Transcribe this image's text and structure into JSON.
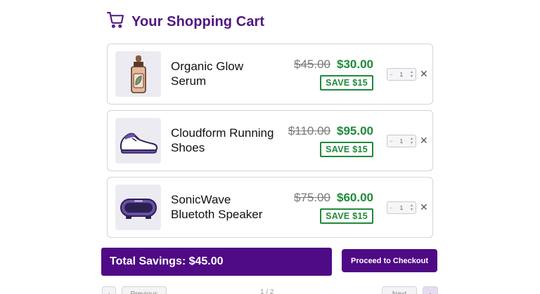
{
  "header": {
    "title": "Your Shopping Cart",
    "icon": "cart-icon",
    "accent": "#4f1782"
  },
  "items": [
    {
      "name": "Organic Glow Serum",
      "original_price": "$45.00",
      "sale_price": "$30.00",
      "savings_badge": "SAVE $15",
      "quantity": "1",
      "icon": "serum-bottle-icon"
    },
    {
      "name": "Cloudform Running Shoes",
      "original_price": "$110.00",
      "sale_price": "$95.00",
      "savings_badge": "SAVE $15",
      "quantity": "1",
      "icon": "running-shoe-icon"
    },
    {
      "name": "SonicWave Bluetoth Speaker",
      "original_price": "$75.00",
      "sale_price": "$60.00",
      "savings_badge": "SAVE $15",
      "quantity": "1",
      "icon": "speaker-icon"
    }
  ],
  "summary": {
    "total_savings": "Total Savings: $45.00",
    "checkout_label": "Proceed to Checkout"
  },
  "pagination": {
    "prev_label": "Previous",
    "page_text": "1 / 2",
    "next_label": "Next"
  },
  "colors": {
    "brand_purple": "#4f0a85",
    "sale_green": "#1f8a3a"
  }
}
